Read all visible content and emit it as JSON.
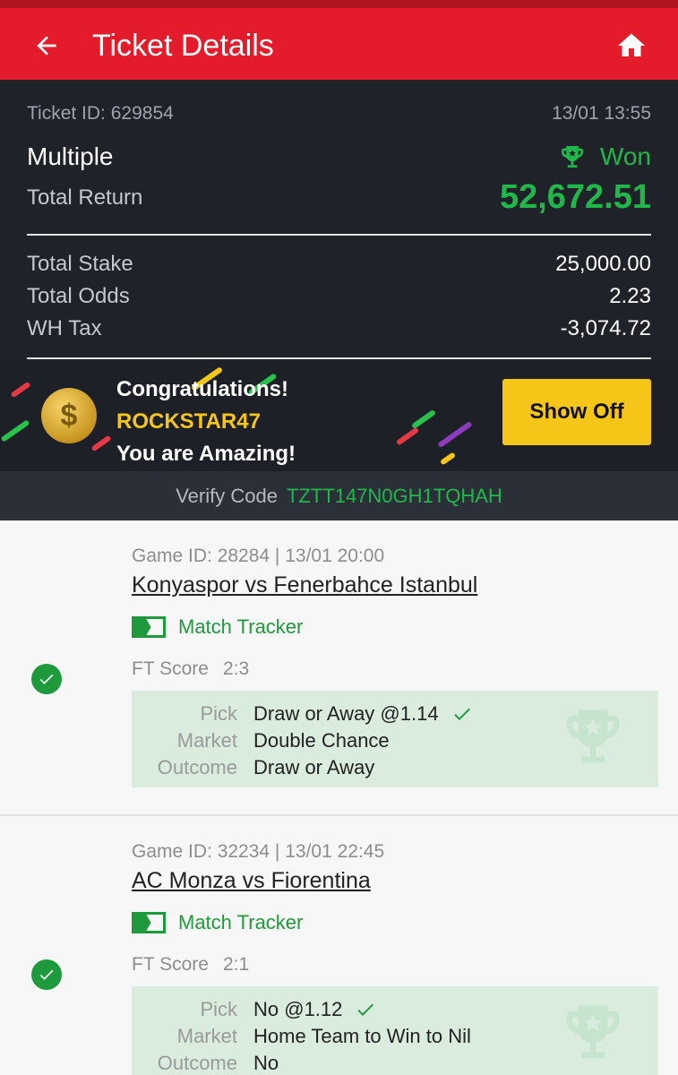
{
  "header": {
    "title": "Ticket Details"
  },
  "ticket": {
    "id_label": "Ticket ID: 629854",
    "datetime": "13/01 13:55",
    "bet_type": "Multiple",
    "status": "Won",
    "total_return_label": "Total Return",
    "total_return": "52,672.51",
    "stake_label": "Total Stake",
    "stake": "25,000.00",
    "odds_label": "Total Odds",
    "odds": "2.23",
    "tax_label": "WH Tax",
    "tax": "-3,074.72"
  },
  "banner": {
    "line1": "Congratulations!",
    "username": "ROCKSTAR47",
    "line3": "You are Amazing!",
    "button": "Show Off"
  },
  "verify": {
    "label": "Verify Code",
    "code": "TZTT147N0GH1TQHAH"
  },
  "legs": [
    {
      "meta": "Game ID: 28284 | 13/01 20:00",
      "match": "Konyaspor vs Fenerbahce Istanbul",
      "tracker": "Match Tracker",
      "ft_label": "FT Score",
      "ft_score": "2:3",
      "pick_label": "Pick",
      "pick": "Draw or Away @1.14",
      "market_label": "Market",
      "market": "Double Chance",
      "outcome_label": "Outcome",
      "outcome": "Draw or Away"
    },
    {
      "meta": "Game ID: 32234 | 13/01 22:45",
      "match": "AC Monza vs Fiorentina",
      "tracker": "Match Tracker",
      "ft_label": "FT Score",
      "ft_score": "2:1",
      "pick_label": "Pick",
      "pick": "No @1.12",
      "market_label": "Market",
      "market": "Home Team to Win to Nil",
      "outcome_label": "Outcome",
      "outcome": "No"
    }
  ],
  "colors": {
    "brand_red": "#e41b2b",
    "won_green": "#1fb94a",
    "accent_yellow": "#f5c518"
  }
}
